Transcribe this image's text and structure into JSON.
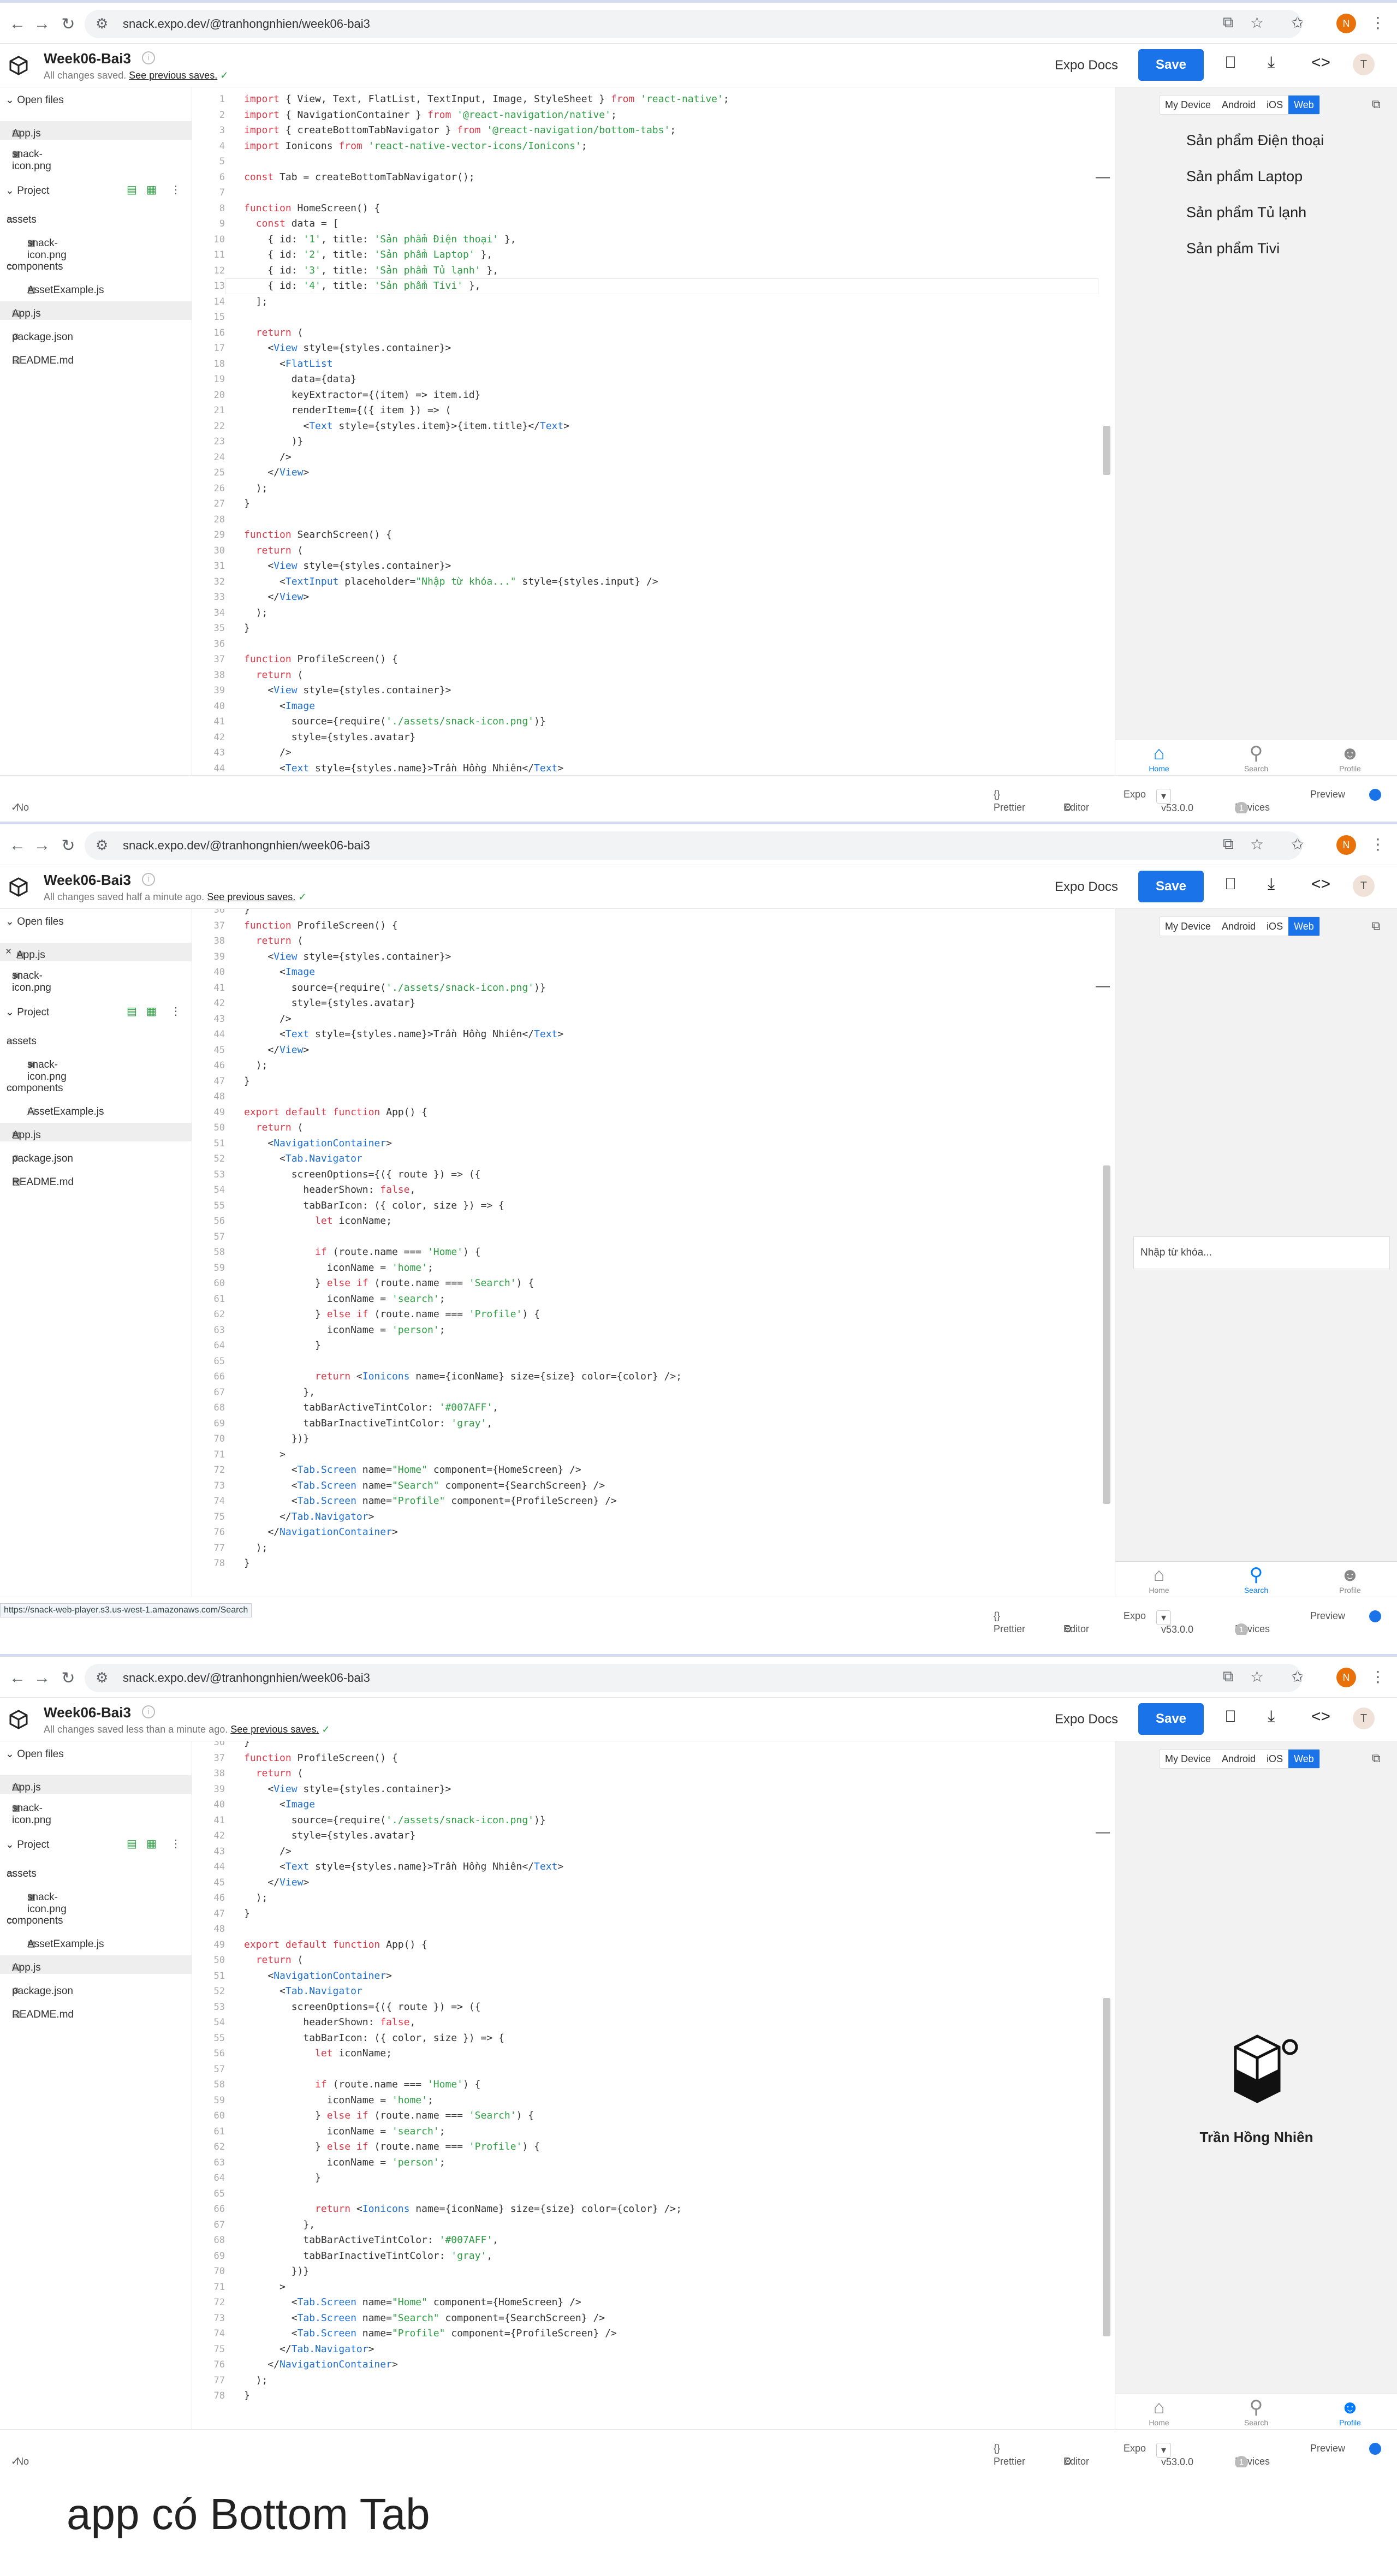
{
  "browser": {
    "url": "snack.expo.dev/@tranhongnhien/week06-bai3",
    "profile_initial": "N"
  },
  "app": {
    "project_title": "Week06-Bai3",
    "user_initial": "T",
    "expo_docs": "Expo Docs",
    "save_label": "Save",
    "see_previous": "See previous saves.",
    "saved_status": [
      "All changes saved.",
      "All changes saved half a minute ago.",
      "All changes saved less than a minute ago."
    ]
  },
  "sidebar": {
    "open_files_header": "Open files",
    "open_files": [
      "App.js",
      "snack-icon.png"
    ],
    "project_header": "Project",
    "tree": [
      "assets",
      "snack-icon.png",
      "components",
      "AssetExample.js",
      "App.js",
      "package.json",
      "README.md"
    ]
  },
  "code": {
    "top": [
      {
        "n": "1",
        "t": "import { View, Text, FlatList, TextInput, Image, StyleSheet } from 'react-native';"
      },
      {
        "n": "2",
        "t": "import { NavigationContainer } from '@react-navigation/native';"
      },
      {
        "n": "3",
        "t": "import { createBottomTabNavigator } from '@react-navigation/bottom-tabs';"
      },
      {
        "n": "4",
        "t": "import Ionicons from 'react-native-vector-icons/Ionicons';"
      },
      {
        "n": "5",
        "t": ""
      },
      {
        "n": "6",
        "t": "const Tab = createBottomTabNavigator();"
      },
      {
        "n": "7",
        "t": ""
      },
      {
        "n": "8",
        "t": "function HomeScreen() {"
      },
      {
        "n": "9",
        "t": "  const data = ["
      },
      {
        "n": "10",
        "t": "    { id: '1', title: 'Sản phẩm Điện thoại' },"
      },
      {
        "n": "11",
        "t": "    { id: '2', title: 'Sản phẩm Laptop' },"
      },
      {
        "n": "12",
        "t": "    { id: '3', title: 'Sản phẩm Tủ lạnh' },"
      },
      {
        "n": "13",
        "t": "    { id: '4', title: 'Sản phẩm Tivi' },"
      },
      {
        "n": "14",
        "t": "  ];"
      },
      {
        "n": "15",
        "t": ""
      },
      {
        "n": "16",
        "t": "  return ("
      },
      {
        "n": "17",
        "t": "    <View style={styles.container}>"
      },
      {
        "n": "18",
        "t": "      <FlatList"
      },
      {
        "n": "19",
        "t": "        data={data}"
      },
      {
        "n": "20",
        "t": "        keyExtractor={(item) => item.id}"
      },
      {
        "n": "21",
        "t": "        renderItem={({ item }) => ("
      },
      {
        "n": "22",
        "t": "          <Text style={styles.item}>{item.title}</Text>"
      },
      {
        "n": "23",
        "t": "        )}"
      },
      {
        "n": "24",
        "t": "      />"
      },
      {
        "n": "25",
        "t": "    </View>"
      },
      {
        "n": "26",
        "t": "  );"
      },
      {
        "n": "27",
        "t": "}"
      },
      {
        "n": "28",
        "t": ""
      },
      {
        "n": "29",
        "t": "function SearchScreen() {"
      },
      {
        "n": "30",
        "t": "  return ("
      },
      {
        "n": "31",
        "t": "    <View style={styles.container}>"
      },
      {
        "n": "32",
        "t": "      <TextInput placeholder=\"Nhập từ khóa...\" style={styles.input} />"
      },
      {
        "n": "33",
        "t": "    </View>"
      },
      {
        "n": "34",
        "t": "  );"
      },
      {
        "n": "35",
        "t": "}"
      },
      {
        "n": "36",
        "t": ""
      },
      {
        "n": "37",
        "t": "function ProfileScreen() {"
      },
      {
        "n": "38",
        "t": "  return ("
      },
      {
        "n": "39",
        "t": "    <View style={styles.container}>"
      },
      {
        "n": "40",
        "t": "      <Image"
      },
      {
        "n": "41",
        "t": "        source={require('./assets/snack-icon.png')}"
      },
      {
        "n": "42",
        "t": "        style={styles.avatar}"
      },
      {
        "n": "43",
        "t": "      />"
      },
      {
        "n": "44",
        "t": "      <Text style={styles.name}>Trần Hồng Nhiên</Text>"
      }
    ],
    "bottom": [
      {
        "n": "36",
        "t": "}"
      },
      {
        "n": "37",
        "t": "function ProfileScreen() {"
      },
      {
        "n": "38",
        "t": "  return ("
      },
      {
        "n": "39",
        "t": "    <View style={styles.container}>"
      },
      {
        "n": "40",
        "t": "      <Image"
      },
      {
        "n": "41",
        "t": "        source={require('./assets/snack-icon.png')}"
      },
      {
        "n": "42",
        "t": "        style={styles.avatar}"
      },
      {
        "n": "43",
        "t": "      />"
      },
      {
        "n": "44",
        "t": "      <Text style={styles.name}>Trần Hồng Nhiên</Text>"
      },
      {
        "n": "45",
        "t": "    </View>"
      },
      {
        "n": "46",
        "t": "  );"
      },
      {
        "n": "47",
        "t": "}"
      },
      {
        "n": "48",
        "t": ""
      },
      {
        "n": "49",
        "t": "export default function App() {"
      },
      {
        "n": "50",
        "t": "  return ("
      },
      {
        "n": "51",
        "t": "    <NavigationContainer>"
      },
      {
        "n": "52",
        "t": "      <Tab.Navigator"
      },
      {
        "n": "53",
        "t": "        screenOptions={({ route }) => ({"
      },
      {
        "n": "54",
        "t": "          headerShown: false,"
      },
      {
        "n": "55",
        "t": "          tabBarIcon: ({ color, size }) => {"
      },
      {
        "n": "56",
        "t": "            let iconName;"
      },
      {
        "n": "57",
        "t": ""
      },
      {
        "n": "58",
        "t": "            if (route.name === 'Home') {"
      },
      {
        "n": "59",
        "t": "              iconName = 'home';"
      },
      {
        "n": "60",
        "t": "            } else if (route.name === 'Search') {"
      },
      {
        "n": "61",
        "t": "              iconName = 'search';"
      },
      {
        "n": "62",
        "t": "            } else if (route.name === 'Profile') {"
      },
      {
        "n": "63",
        "t": "              iconName = 'person';"
      },
      {
        "n": "64",
        "t": "            }"
      },
      {
        "n": "65",
        "t": ""
      },
      {
        "n": "66",
        "t": "            return <Ionicons name={iconName} size={size} color={color} />;"
      },
      {
        "n": "67",
        "t": "          },"
      },
      {
        "n": "68",
        "t": "          tabBarActiveTintColor: '#007AFF',"
      },
      {
        "n": "69",
        "t": "          tabBarInactiveTintColor: 'gray',"
      },
      {
        "n": "70",
        "t": "        })}"
      },
      {
        "n": "71",
        "t": "      >"
      },
      {
        "n": "72",
        "t": "        <Tab.Screen name=\"Home\" component={HomeScreen} />"
      },
      {
        "n": "73",
        "t": "        <Tab.Screen name=\"Search\" component={SearchScreen} />"
      },
      {
        "n": "74",
        "t": "        <Tab.Screen name=\"Profile\" component={ProfileScreen} />"
      },
      {
        "n": "75",
        "t": "      </Tab.Navigator>"
      },
      {
        "n": "76",
        "t": "    </NavigationContainer>"
      },
      {
        "n": "77",
        "t": "  );"
      },
      {
        "n": "78",
        "t": "}"
      }
    ]
  },
  "preview": {
    "segments": [
      "My Device",
      "Android",
      "iOS",
      "Web"
    ],
    "home_items": [
      "Sản phẩm Điện thoại",
      "Sản phẩm Laptop",
      "Sản phẩm Tủ lạnh",
      "Sản phẩm Tivi"
    ],
    "search_placeholder": "Nhập từ khóa...",
    "profile_name": "Trần Hồng Nhiên",
    "tabs": [
      "Home",
      "Search",
      "Profile"
    ],
    "active_color": "#007AFF"
  },
  "status": {
    "errors": "No errors",
    "prettier": "Prettier",
    "editor": "Editor",
    "expo": "Expo",
    "version": "v53.0.0",
    "devices": "Devices",
    "devices_count": "1",
    "preview": "Preview",
    "hover_url": "https://snack-web-player.s3.us-west-1.amazonaws.com/Search"
  },
  "caption": "app có Bottom Tab"
}
